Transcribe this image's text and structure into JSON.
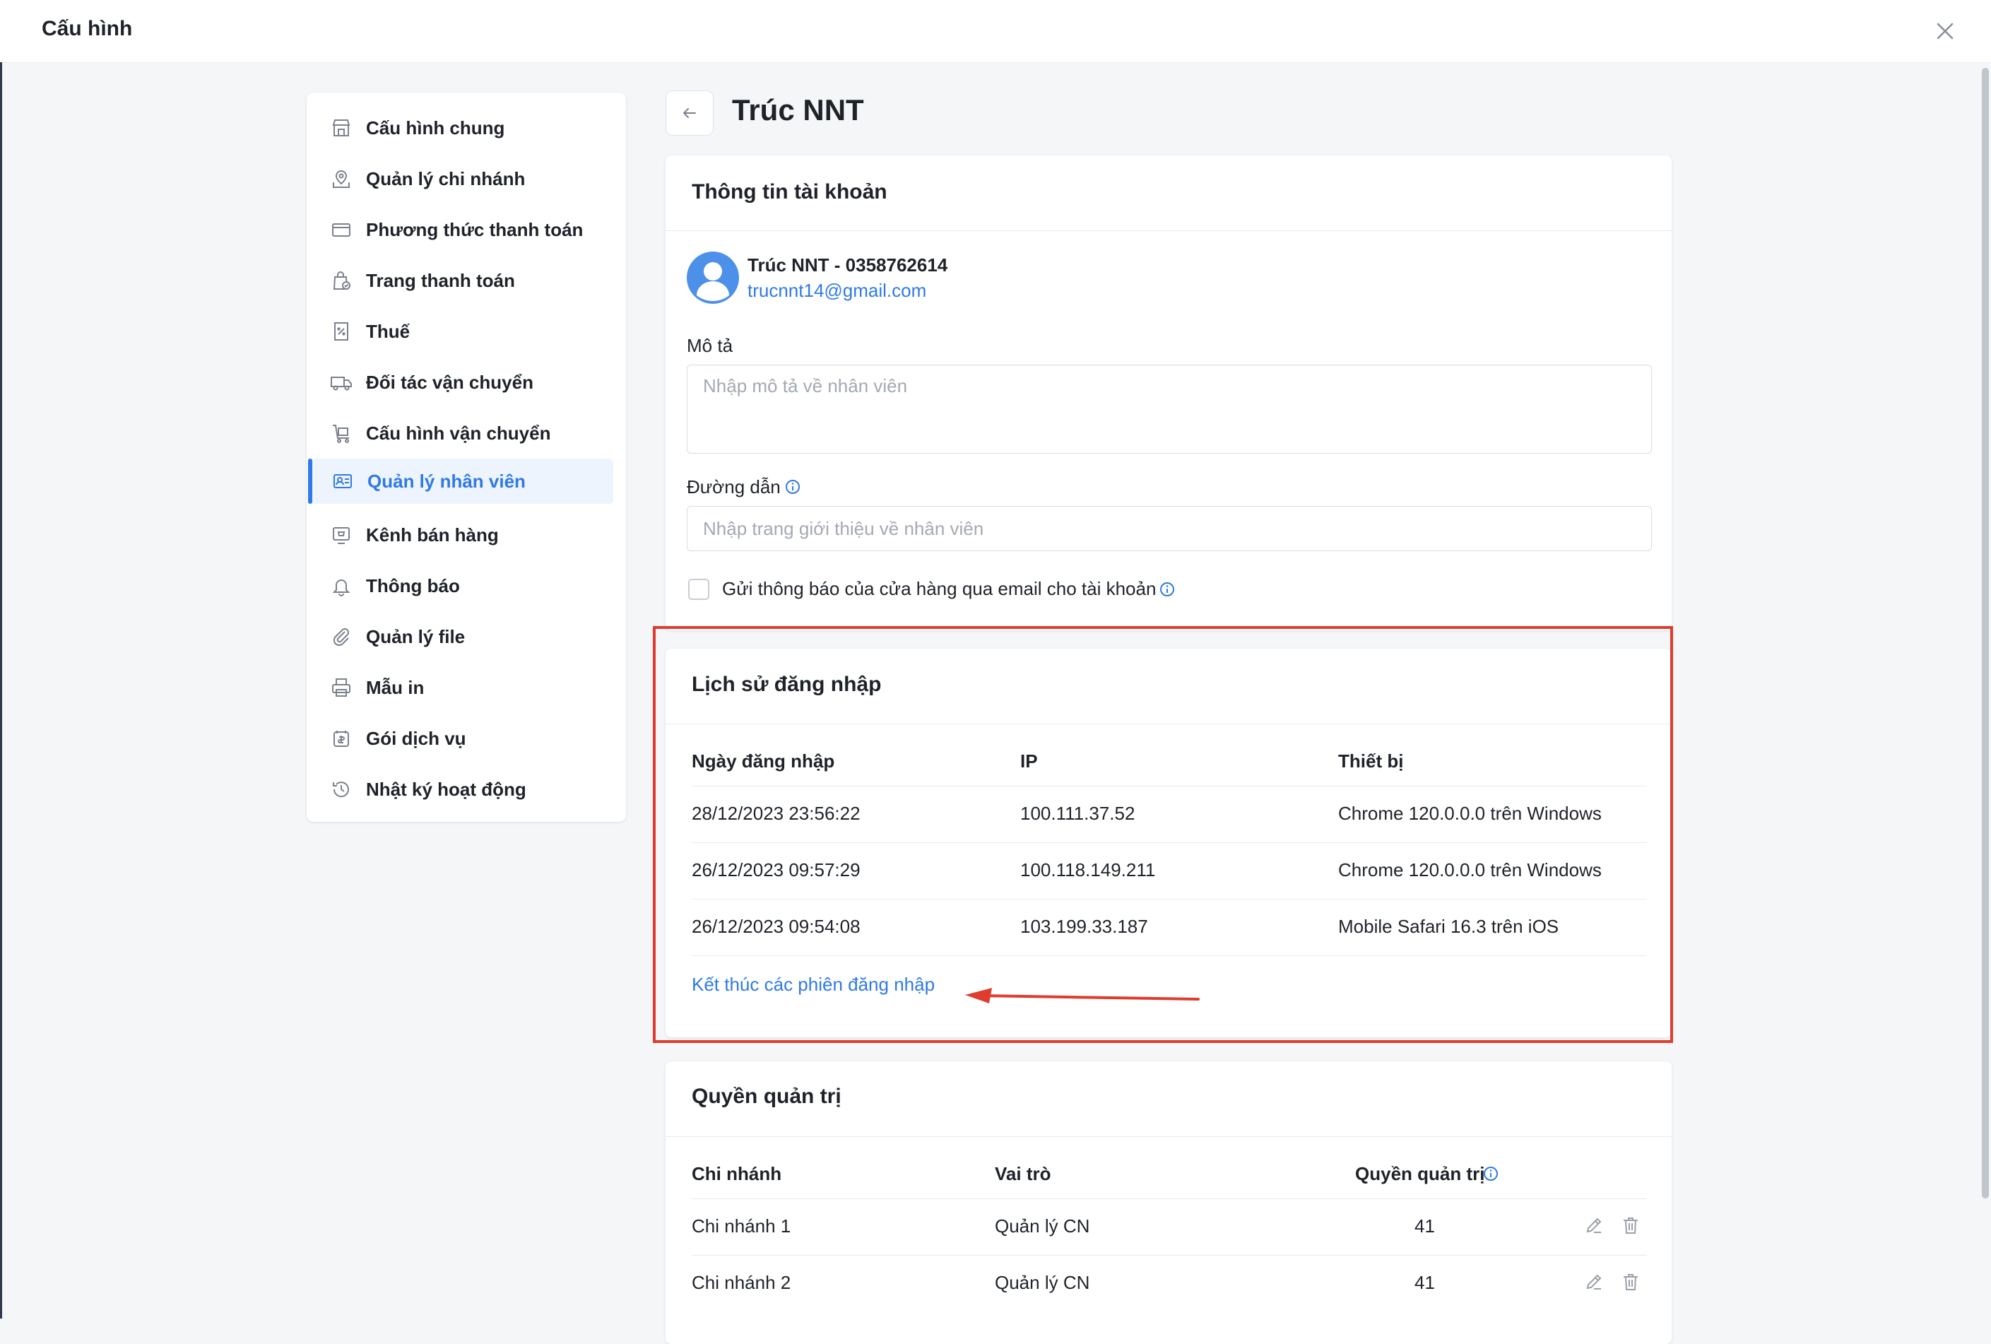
{
  "window": {
    "title": "Cấu hình"
  },
  "sidebar": {
    "items": [
      {
        "label": "Cấu hình chung",
        "icon": "store-icon"
      },
      {
        "label": "Quản lý chi nhánh",
        "icon": "branch-map-icon"
      },
      {
        "label": "Phương thức thanh toán",
        "icon": "credit-card-icon"
      },
      {
        "label": "Trang thanh toán",
        "icon": "checkout-bag-icon"
      },
      {
        "label": "Thuế",
        "icon": "tax-receipt-icon"
      },
      {
        "label": "Đối tác vận chuyển",
        "icon": "truck-icon"
      },
      {
        "label": "Cấu hình vận chuyển",
        "icon": "shipping-cart-icon"
      },
      {
        "label": "Quản lý nhân viên",
        "icon": "staff-card-icon",
        "active": true
      },
      {
        "label": "Kênh bán hàng",
        "icon": "sales-channel-icon"
      },
      {
        "label": "Thông báo",
        "icon": "bell-icon"
      },
      {
        "label": "Quản lý file",
        "icon": "paperclip-icon"
      },
      {
        "label": "Mẫu in",
        "icon": "printer-icon"
      },
      {
        "label": "Gói dịch vụ",
        "icon": "service-package-icon"
      },
      {
        "label": "Nhật ký hoạt động",
        "icon": "history-icon"
      }
    ]
  },
  "header": {
    "title": "Trúc NNT"
  },
  "account": {
    "section_title": "Thông tin tài khoản",
    "name_phone": "Trúc NNT - 0358762614",
    "email": "trucnnt14@gmail.com",
    "desc_label": "Mô tả",
    "desc_placeholder": "Nhập mô tả về nhân viên",
    "path_label": "Đường dẫn",
    "path_placeholder": "Nhập trang giới thiệu về nhân viên",
    "notify_label": "Gửi thông báo của cửa hàng qua email cho tài khoản",
    "notify_checked": false
  },
  "login_history": {
    "section_title": "Lịch sử đăng nhập",
    "columns": [
      "Ngày đăng nhập",
      "IP",
      "Thiết bị"
    ],
    "rows": [
      [
        "28/12/2023 23:56:22",
        "100.111.37.52",
        "Chrome 120.0.0.0 trên Windows"
      ],
      [
        "26/12/2023 09:57:29",
        "100.118.149.211",
        "Chrome 120.0.0.0 trên Windows"
      ],
      [
        "26/12/2023 09:54:08",
        "103.199.33.187",
        "Mobile Safari 16.3 trên iOS"
      ]
    ],
    "end_sessions_link": "Kết thúc các phiên đăng nhập"
  },
  "admin_rights": {
    "section_title": "Quyền quản trị",
    "columns": [
      "Chi nhánh",
      "Vai trò",
      "Quyền quản trị"
    ],
    "rows": [
      [
        "Chi nhánh 1",
        "Quản lý CN",
        "41"
      ],
      [
        "Chi nhánh 2",
        "Quản lý CN",
        "41"
      ]
    ]
  },
  "colors": {
    "accent": "#2f7ae5",
    "highlight": "#e03c2e",
    "avatar": "#4d90ea"
  }
}
